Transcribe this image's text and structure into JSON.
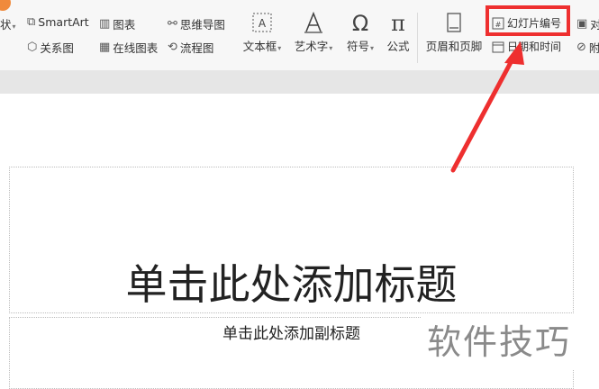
{
  "ribbon": {
    "cut_label": "状",
    "smartart": "SmartArt",
    "chart": "图表",
    "mindmap": "思维导图",
    "relation": "关系图",
    "online_chart": "在线图表",
    "flowchart": "流程图",
    "textbox": "文本框",
    "wordart": "艺术字",
    "symbol": "符号",
    "formula": "公式",
    "header_footer": "页眉和页脚",
    "slide_number": "幻灯片编号",
    "date_time": "日期和时间",
    "object_cut": "对",
    "attach_cut": "附"
  },
  "slide": {
    "title_placeholder": "单击此处添加标题",
    "subtitle_placeholder": "单击此处添加副标题"
  },
  "watermark": "软件技巧",
  "colors": {
    "highlight": "#ee2f2f",
    "accent": "#f08a3c"
  }
}
